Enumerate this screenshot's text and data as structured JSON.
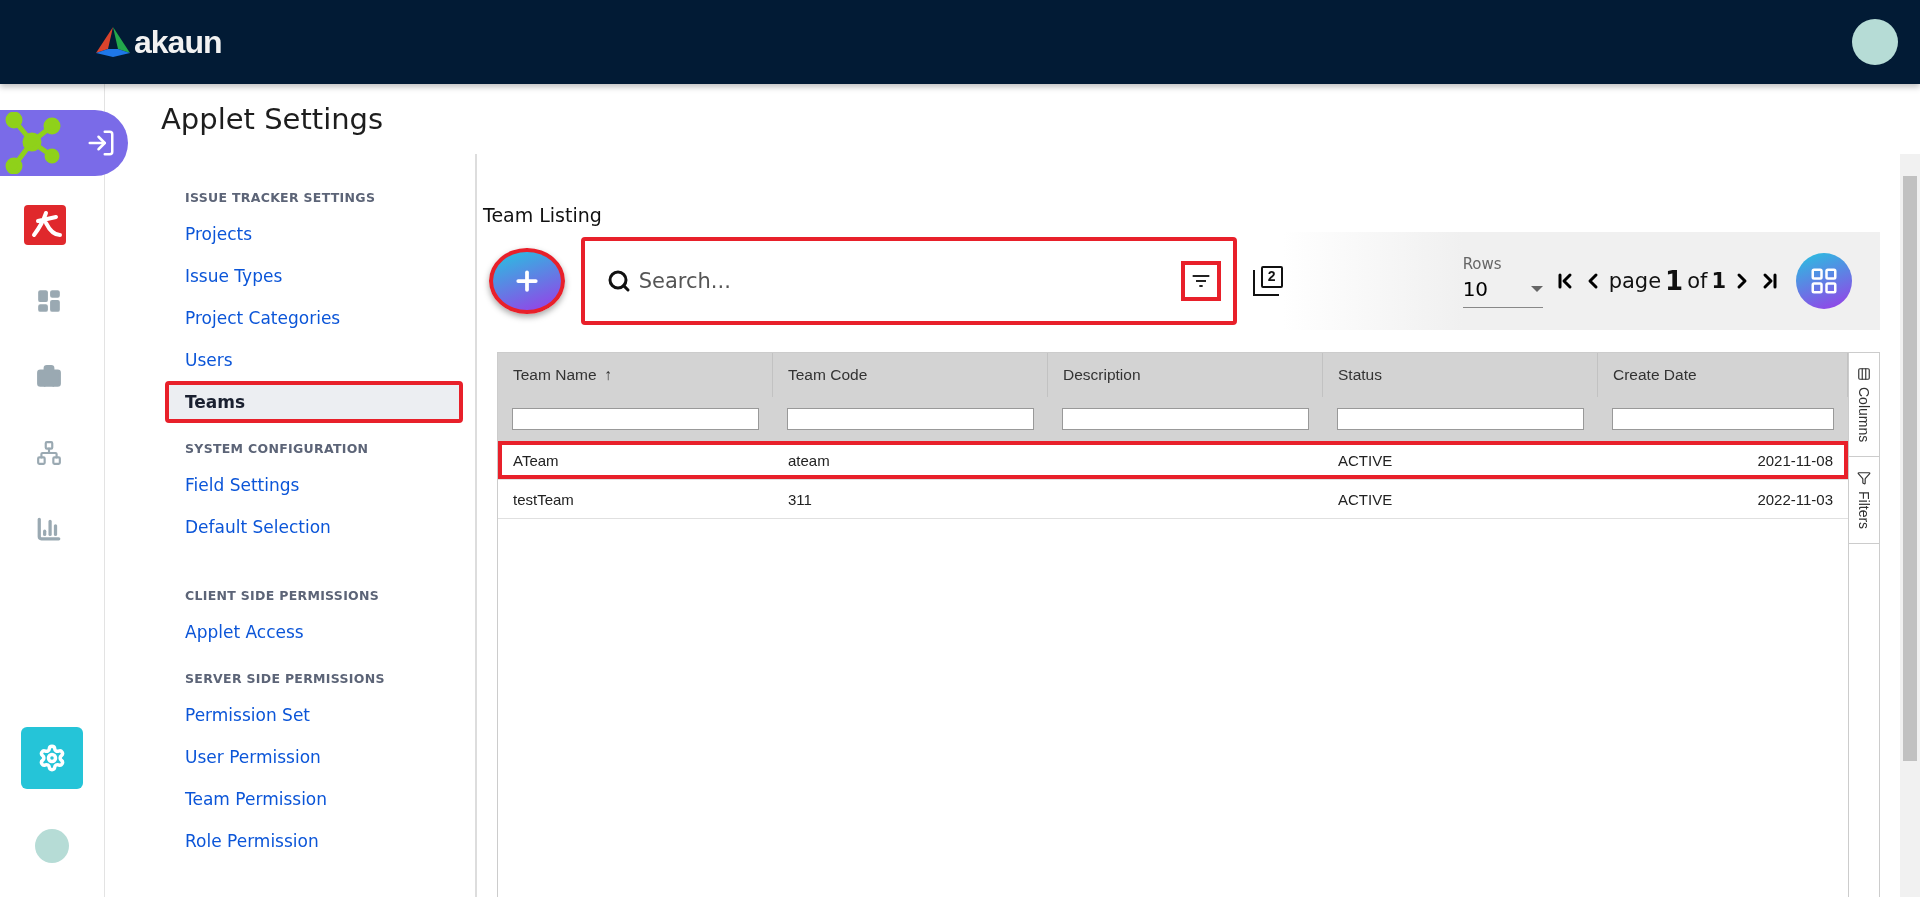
{
  "header": {
    "logo": "akaun"
  },
  "rail": [
    {
      "kind": "applet",
      "selected": true
    },
    {
      "kind": "app",
      "selected": false
    },
    {
      "kind": "dashboard",
      "selected": false
    },
    {
      "kind": "briefcase",
      "selected": false
    },
    {
      "kind": "network",
      "selected": false
    },
    {
      "kind": "chart",
      "selected": false
    },
    {
      "kind": "settings",
      "selected": true
    },
    {
      "kind": "avatar",
      "selected": false
    }
  ],
  "page": {
    "title": "Applet Settings"
  },
  "settings_nav": [
    {
      "heading": "ISSUE TRACKER SETTINGS",
      "items": [
        {
          "label": "Projects",
          "selected": false,
          "highlighted": false
        },
        {
          "label": "Issue Types",
          "selected": false,
          "highlighted": false
        },
        {
          "label": "Project Categories",
          "selected": false,
          "highlighted": false
        },
        {
          "label": "Users",
          "selected": false,
          "highlighted": false
        },
        {
          "label": "Teams",
          "selected": true,
          "highlighted": true
        }
      ]
    },
    {
      "heading": "SYSTEM CONFIGURATION",
      "items": [
        {
          "label": "Field Settings",
          "selected": false,
          "highlighted": false
        },
        {
          "label": "Default Selection",
          "selected": false,
          "highlighted": false
        }
      ]
    },
    {
      "heading": "CLIENT SIDE PERMISSIONS",
      "items": [
        {
          "label": "Applet Access",
          "selected": false,
          "highlighted": false
        }
      ]
    },
    {
      "heading": "SERVER SIDE PERMISSIONS",
      "items": [
        {
          "label": "Permission Set",
          "selected": false,
          "highlighted": false
        },
        {
          "label": "User Permission",
          "selected": false,
          "highlighted": false
        },
        {
          "label": "Team Permission",
          "selected": false,
          "highlighted": false
        },
        {
          "label": "Role Permission",
          "selected": false,
          "highlighted": false
        }
      ]
    }
  ],
  "listing": {
    "title": "Team Listing",
    "add_button": {
      "highlighted": true
    },
    "search": {
      "placeholder": "Search...",
      "highlighted": true,
      "filter_highlighted": true
    },
    "layers_count": "2",
    "rows_label": "Rows",
    "rows_value": "10",
    "pager": {
      "page_word": "page",
      "page": "1",
      "of_word": "of",
      "pages": "1"
    },
    "columns": [
      {
        "label": "Team Name",
        "sort": "↑"
      },
      {
        "label": "Team Code"
      },
      {
        "label": "Description"
      },
      {
        "label": "Status"
      },
      {
        "label": "Create Date"
      }
    ],
    "rows": [
      {
        "cells": [
          "ATeam",
          "ateam",
          "",
          "ACTIVE",
          "2021-11-08"
        ],
        "highlighted": true
      },
      {
        "cells": [
          "testTeam",
          "311",
          "",
          "ACTIVE",
          "2022-11-03"
        ],
        "highlighted": false
      }
    ],
    "side_tabs": [
      {
        "kind": "columns",
        "label": "Columns"
      },
      {
        "kind": "filters",
        "label": "Filters"
      }
    ]
  }
}
